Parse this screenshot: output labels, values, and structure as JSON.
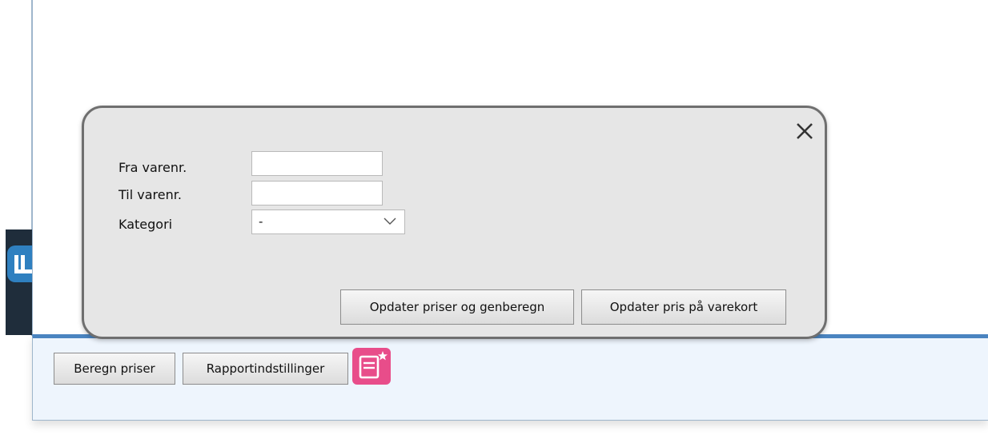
{
  "dialog": {
    "fields": {
      "fra_label": "Fra varenr.",
      "fra_value": "",
      "til_label": "Til varenr.",
      "til_value": "",
      "kategori_label": "Kategori",
      "kategori_selected": "-"
    },
    "buttons": {
      "update_recalc": "Opdater priser og genberegn",
      "update_card": "Opdater pris på varekort"
    },
    "close_icon": "close-icon"
  },
  "toolbar": {
    "beregn_label": "Beregn priser",
    "rapport_label": "Rapportindstillinger",
    "note_icon": "note-add-icon"
  },
  "colors": {
    "dialog_bg": "#e6e6e6",
    "dialog_border": "#6f6f6f",
    "panel_bg": "#eef5fd",
    "panel_accent": "#4a84c0",
    "note_icon_bg": "#e84d8a",
    "sidebar_dark": "#1f2d3b",
    "logo_blue": "#2f80c0"
  }
}
